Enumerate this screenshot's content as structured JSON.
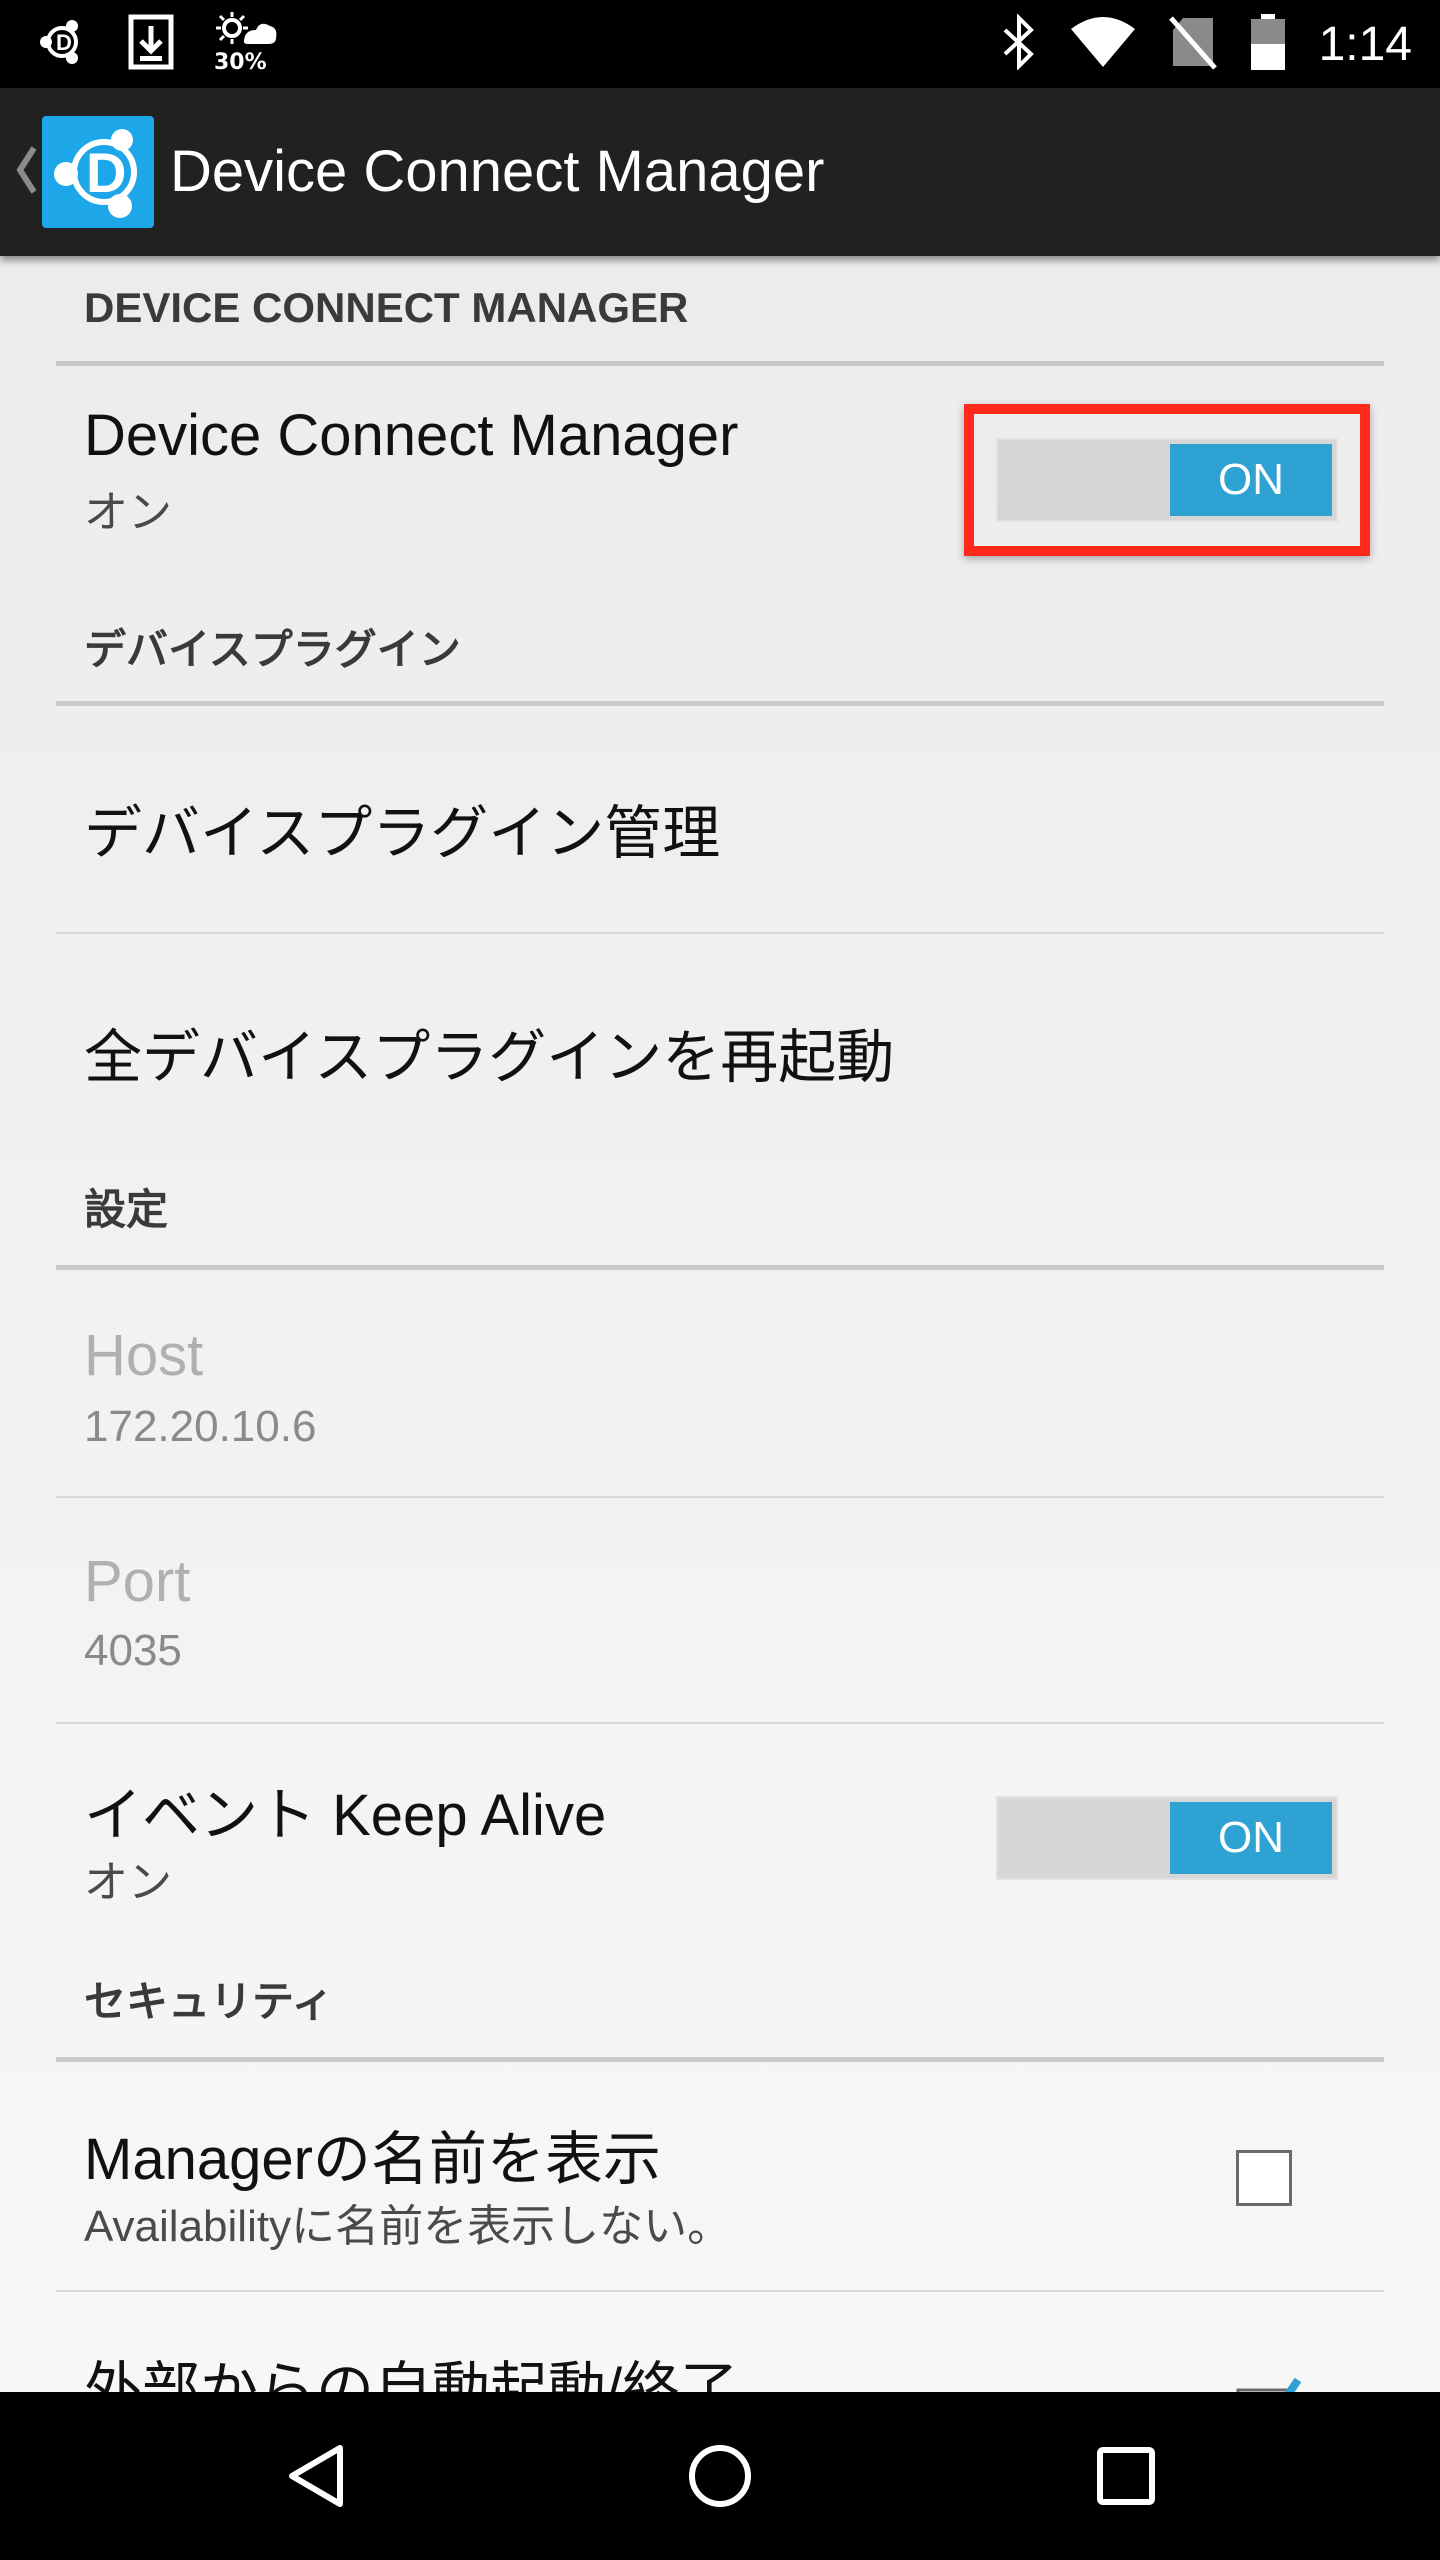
{
  "status_bar": {
    "time": "1:14",
    "weather_percent": "30%",
    "icons_left": [
      "device-connect-notification-icon",
      "download-icon",
      "weather-icon"
    ],
    "icons_right": [
      "bluetooth-icon",
      "wifi-icon",
      "no-sim-icon",
      "battery-icon"
    ]
  },
  "action_bar": {
    "title": "Device Connect Manager",
    "logo_color": "#1ea7e8"
  },
  "sections": {
    "manager": {
      "header": "DEVICE CONNECT MANAGER",
      "pref_title": "Device Connect Manager",
      "pref_summary": "オン",
      "switch_label": "ON"
    },
    "plugins": {
      "header": "デバイスプラグイン",
      "manage": "デバイスプラグイン管理",
      "restart_all": "全デバイスプラグインを再起動"
    },
    "settings": {
      "header": "設定",
      "host_title": "Host",
      "host_value": "172.20.10.6",
      "port_title": "Port",
      "port_value": "4035",
      "keepalive_title": "イベント Keep Alive",
      "keepalive_summary": "オン",
      "keepalive_switch_label": "ON"
    },
    "security": {
      "header": "セキュリティ",
      "show_name_title": "Managerの名前を表示",
      "show_name_summary": "Availabilityに名前を表示しない。",
      "show_name_checked": false,
      "external_title": "外部からの自動起動/終了",
      "external_checked": true
    }
  },
  "colors": {
    "accent": "#2ea2d2",
    "highlight": "#ff2a1a",
    "action_bar": "#212121"
  },
  "nav": {
    "buttons": [
      "back-icon",
      "home-icon",
      "recents-icon"
    ]
  }
}
